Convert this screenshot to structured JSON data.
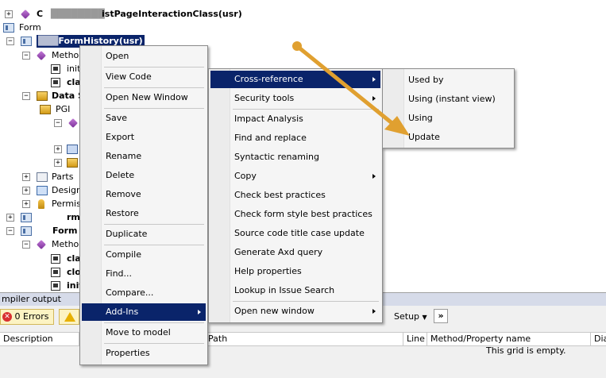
{
  "tree": {
    "items": [
      {
        "label": "C",
        "label_tail": "istPageInteractionClass(usr)"
      },
      {
        "label": "Form"
      },
      {
        "label": "FormHistory(usr)"
      },
      {
        "label": "Method"
      },
      {
        "label": "init"
      },
      {
        "label": "cla"
      },
      {
        "label": "Data S"
      },
      {
        "label": "PGI"
      },
      {
        "label": "Parts"
      },
      {
        "label": "Designs"
      },
      {
        "label": "Permiss"
      },
      {
        "label": "rm("
      },
      {
        "label": "Form"
      },
      {
        "label": "Method"
      },
      {
        "label": "cla"
      },
      {
        "label": "clo"
      },
      {
        "label": "init"
      }
    ]
  },
  "context_menu": {
    "items": [
      "Open",
      "View Code",
      "Open New Window",
      "Save",
      "Export",
      "Rename",
      "Delete",
      "Remove",
      "Restore",
      "Duplicate",
      "Compile",
      "Find...",
      "Compare...",
      "Add-Ins",
      "Move to model",
      "Properties"
    ],
    "highlighted": "Add-Ins"
  },
  "addins_menu": {
    "items": [
      "Cross-reference",
      "Security tools",
      "Impact Analysis",
      "Find and replace",
      "Syntactic renaming",
      "Copy",
      "Check best practices",
      "Check form style best practices",
      "Source code title case update",
      "Generate Axd query",
      "Help properties",
      "Lookup in Issue Search",
      "Open new window"
    ],
    "highlighted": "Cross-reference"
  },
  "crossref_menu": {
    "items": [
      "Used by",
      "Using (instant view)",
      "Using",
      "Update"
    ]
  },
  "compiler": {
    "title": "mpiler output",
    "errors_label": "0 Errors",
    "setup_label": "Setup",
    "chevron": "»",
    "columns": [
      "Description",
      "Path",
      "Line",
      "Method/Property name",
      "Dia"
    ],
    "empty_message": "This grid is empty."
  },
  "colors": {
    "selection": "#0a246a",
    "annotation_arrow": "#e0a030"
  }
}
